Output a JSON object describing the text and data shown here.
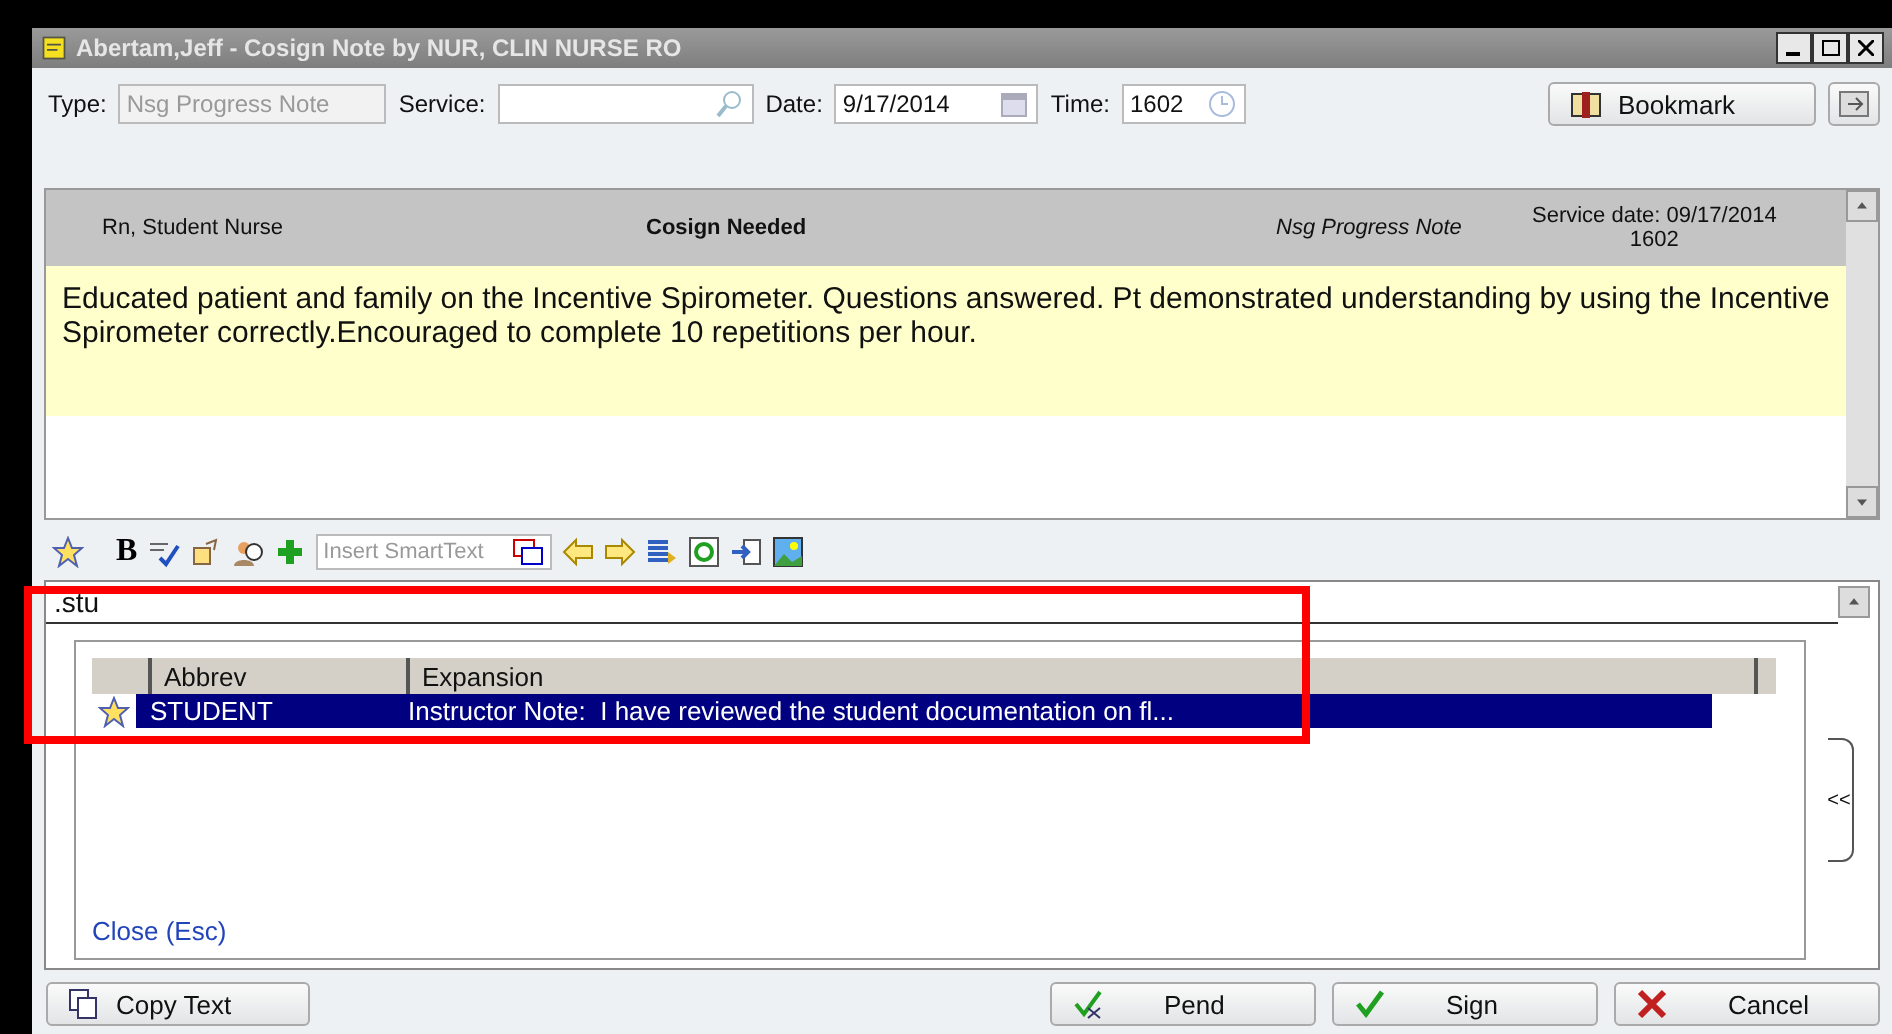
{
  "window": {
    "title": "Abertam,Jeff - Cosign Note by NUR, CLIN NURSE RO"
  },
  "header": {
    "type_label": "Type:",
    "type_value": "Nsg Progress Note",
    "service_label": "Service:",
    "date_label": "Date:",
    "date_value": "9/17/2014",
    "time_label": "Time:",
    "time_value": "1602",
    "bookmark": "Bookmark"
  },
  "note": {
    "author": "Rn, Student Nurse",
    "status": "Cosign Needed",
    "note_type": "Nsg Progress Note",
    "service_date": "Service date: 09/17/2014",
    "service_time": "1602",
    "body": "Educated patient and family on the Incentive Spirometer. Questions answered. Pt demonstrated understanding by using the Incentive Spirometer correctly.Encouraged to complete 10 repetitions per hour."
  },
  "editor_toolbar": {
    "bold": "B",
    "smarttext_placeholder": "Insert SmartText"
  },
  "editor": {
    "typed": ".stu",
    "highlighted": true
  },
  "autotext": {
    "columns": [
      "Abbrev",
      "Expansion"
    ],
    "rows": [
      {
        "abbrev": "STUDENT",
        "expansion": "Instructor Note:  I have reviewed the student documentation on fl...",
        "selected": true
      }
    ],
    "close": "Close (Esc)",
    "collapse": "<<"
  },
  "buttons": {
    "copy": "Copy Text",
    "pend": "Pend",
    "sign": "Sign",
    "cancel": "Cancel"
  }
}
